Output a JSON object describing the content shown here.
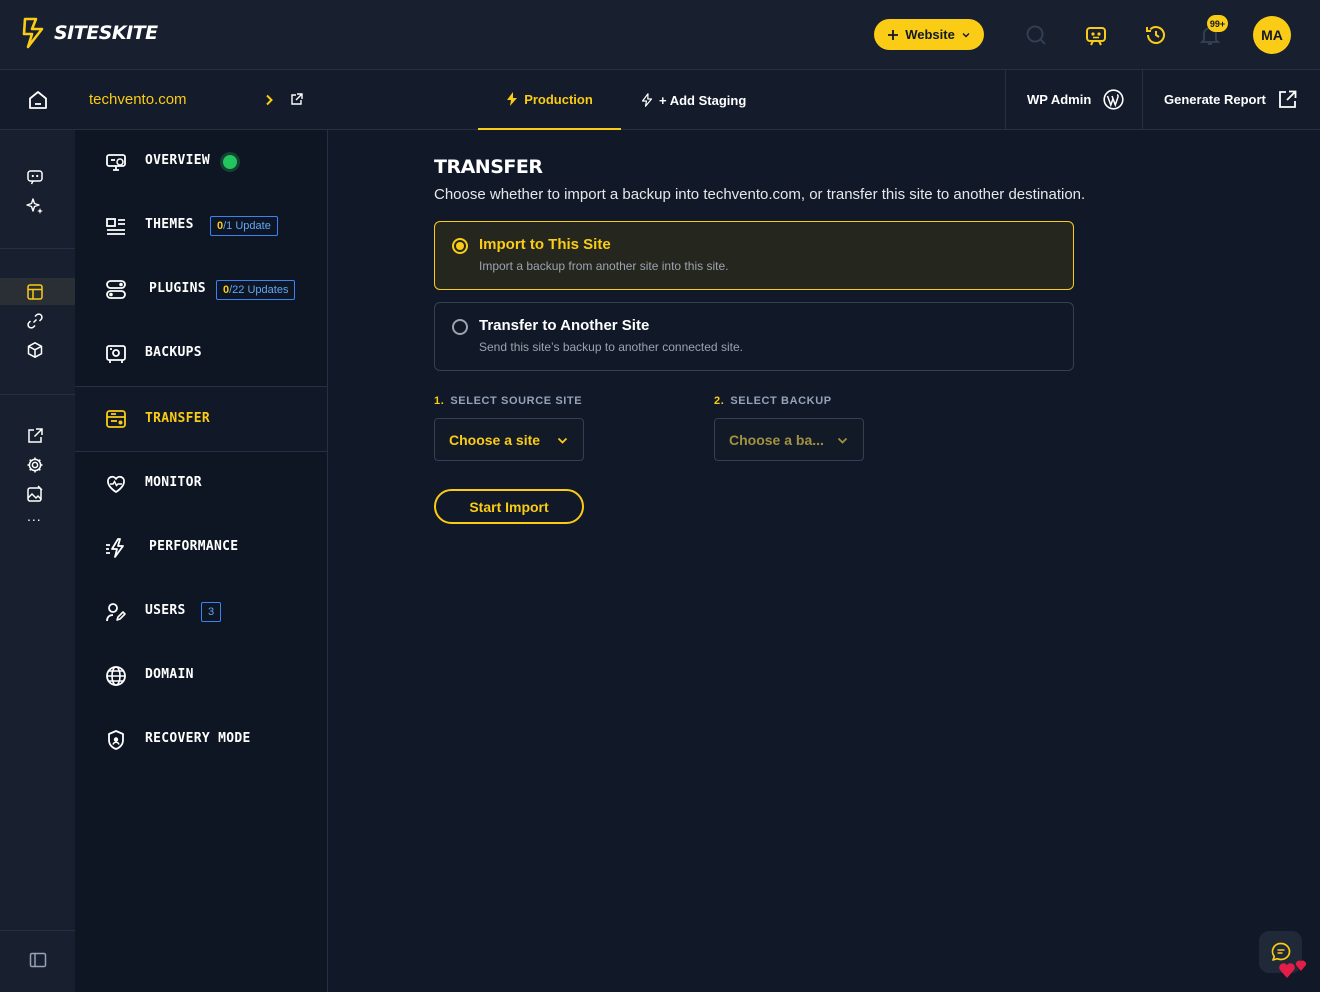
{
  "brand": {
    "name": "SITESKITE",
    "accent": "#facc15"
  },
  "header": {
    "website_button": "Website",
    "notifications_badge": "99+",
    "avatar_initials": "MA",
    "icons": [
      "plus-icon",
      "chevron-down-icon",
      "search-icon",
      "robot-icon",
      "clock-history-icon",
      "bell-icon"
    ]
  },
  "subheader": {
    "site_name": "techvento.com",
    "tabs": [
      {
        "label": "Production",
        "active": true
      },
      {
        "label": "+ Add Staging",
        "active": false
      }
    ],
    "wp_admin": "WP Admin",
    "generate_report": "Generate Report"
  },
  "rail": {
    "icons": [
      "robot-icon",
      "sparkles-icon",
      "layout-icon",
      "link-icon",
      "cube-icon",
      "external-edit-icon",
      "gear-icon",
      "image-edit-icon",
      "more-icon",
      "sidebar-toggle-icon"
    ],
    "more": "..."
  },
  "nav": {
    "items": [
      {
        "label": "OVERVIEW",
        "icon": "monitor-icon"
      },
      {
        "label": "THEMES",
        "icon": "layout-list-icon",
        "badge_hl": "0",
        "badge_rest": "/1 Update"
      },
      {
        "label": "PLUGINS",
        "icon": "toggles-icon",
        "badge_hl": "0",
        "badge_rest": "/22 Updates"
      },
      {
        "label": "BACKUPS",
        "icon": "backup-icon"
      },
      {
        "label": "TRANSFER",
        "icon": "transfer-icon",
        "active": true
      },
      {
        "label": "MONITOR",
        "icon": "heart-pulse-icon"
      },
      {
        "label": "PERFORMANCE",
        "icon": "bolt-speed-icon"
      },
      {
        "label": "USERS",
        "icon": "user-edit-icon",
        "badge_rest": "3"
      },
      {
        "label": "DOMAIN",
        "icon": "globe-icon"
      },
      {
        "label": "RECOVERY MODE",
        "icon": "shield-icon"
      }
    ]
  },
  "main": {
    "title": "TRANSFER",
    "description": "Choose whether to import a backup into techvento.com, or transfer this site to another destination.",
    "options": [
      {
        "title": "Import to This Site",
        "subtitle": "Import a backup from another site into this site.",
        "selected": true
      },
      {
        "title": "Transfer to Another Site",
        "subtitle": "Send this site’s backup to another connected site.",
        "selected": false
      }
    ],
    "source": {
      "number": "1.",
      "label": "SELECT SOURCE SITE",
      "value": "Choose a site"
    },
    "backup": {
      "number": "2.",
      "label": "SELECT BACKUP",
      "value": "Choose a ba..."
    },
    "start_button": "Start Import"
  }
}
